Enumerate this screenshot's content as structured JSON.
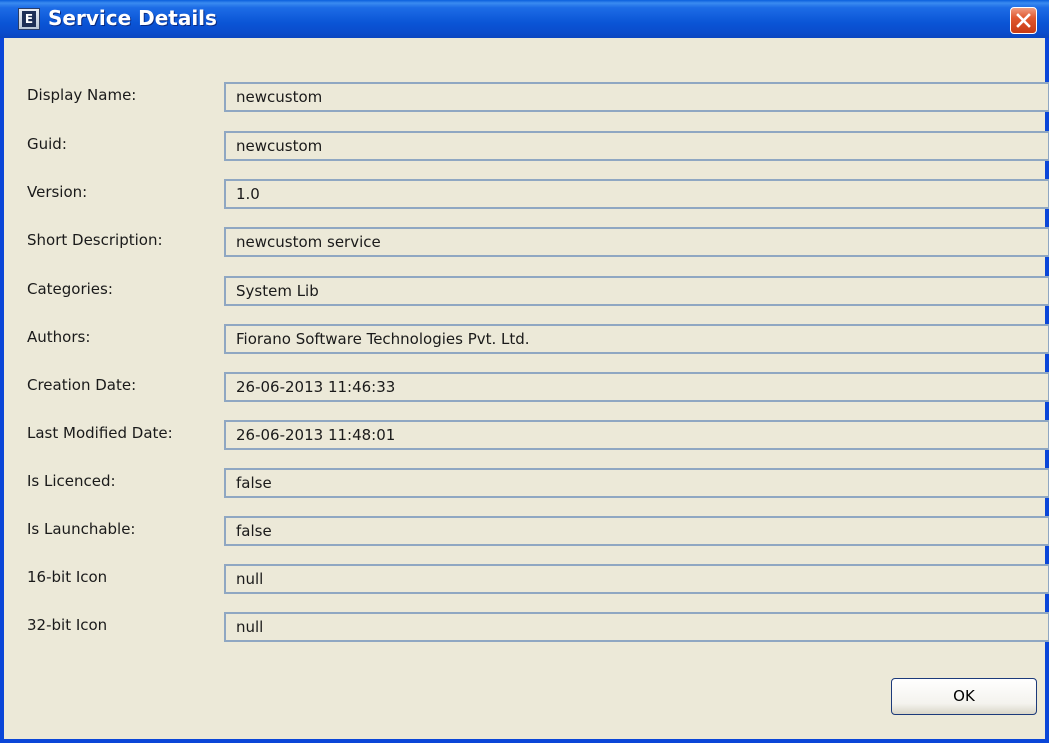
{
  "window": {
    "title": "Service Details",
    "app_icon_letter": "E",
    "icons": {
      "app": "fiorano-app-icon",
      "close": "close-icon"
    },
    "colors": {
      "titlebar": "#0a55d6",
      "frame": "#0a46d8",
      "background": "#ece9d8",
      "close_button": "#e0582f"
    }
  },
  "details": {
    "display_name": {
      "label": "Display Name:",
      "value": "newcustom"
    },
    "guid": {
      "label": "Guid:",
      "value": "newcustom"
    },
    "version": {
      "label": "Version:",
      "value": "1.0"
    },
    "short_description": {
      "label": "Short Description:",
      "value": "newcustom service"
    },
    "categories": {
      "label": "Categories:",
      "value": "System Lib"
    },
    "authors": {
      "label": "Authors:",
      "value": "Fiorano Software Technologies Pvt. Ltd."
    },
    "creation_date": {
      "label": "Creation Date:",
      "value": "26-06-2013 11:46:33"
    },
    "last_modified_date": {
      "label": "Last Modified Date:",
      "value": "26-06-2013 11:48:01"
    },
    "is_licenced": {
      "label": "Is Licenced:",
      "value": "false"
    },
    "is_launchable": {
      "label": "Is Launchable:",
      "value": "false"
    },
    "icon_16": {
      "label": "16-bit Icon",
      "value": "null"
    },
    "icon_32": {
      "label": "32-bit Icon",
      "value": "null"
    }
  },
  "buttons": {
    "ok_label": "OK"
  }
}
